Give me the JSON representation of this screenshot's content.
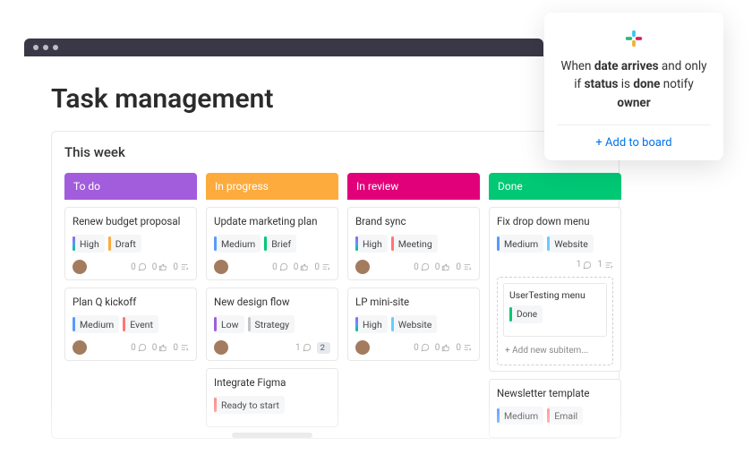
{
  "page": {
    "title": "Task management"
  },
  "board": {
    "title": "This  week"
  },
  "columns": [
    {
      "key": "todo",
      "label": "To do",
      "cards": [
        {
          "title": "Renew budget proposal",
          "tags": [
            {
              "text": "High",
              "bar": "c-grad"
            },
            {
              "text": "Draft",
              "bar": "c-orange"
            }
          ],
          "avatar": true,
          "comments": 0,
          "likes": 0,
          "sub": 0
        },
        {
          "title": "Plan Q kickoff",
          "tags": [
            {
              "text": "Medium",
              "bar": "c-blue"
            },
            {
              "text": "Event",
              "bar": "c-pink"
            }
          ],
          "avatar": true,
          "comments": 0,
          "likes": 0,
          "sub": 0
        }
      ]
    },
    {
      "key": "progress",
      "label": "In progress",
      "cards": [
        {
          "title": "Update marketing plan",
          "tags": [
            {
              "text": "Medium",
              "bar": "c-blue"
            },
            {
              "text": "Brief",
              "bar": "c-teal"
            }
          ],
          "avatar": true,
          "comments": 0,
          "likes": 0,
          "sub": 0
        },
        {
          "title": "New design flow",
          "tags": [
            {
              "text": "Low",
              "bar": "c-purple"
            },
            {
              "text": "Strategy",
              "bar": "c-grey"
            }
          ],
          "avatar": true,
          "comments": 1,
          "likes": null,
          "sub": 2,
          "sub_badge": true
        },
        {
          "title": "Integrate Figma",
          "tags": [
            {
              "text": "Ready to start",
              "bar": "c-salmon"
            }
          ],
          "avatar": false,
          "comments": null,
          "likes": null,
          "sub": null,
          "partial": true
        }
      ]
    },
    {
      "key": "review",
      "label": "In review",
      "cards": [
        {
          "title": "Brand sync",
          "tags": [
            {
              "text": "High",
              "bar": "c-grad"
            },
            {
              "text": "Meeting",
              "bar": "c-pink"
            }
          ],
          "avatar": true,
          "comments": 0,
          "likes": 0,
          "sub": 0
        },
        {
          "title": "LP mini-site",
          "tags": [
            {
              "text": "High",
              "bar": "c-grad"
            },
            {
              "text": "Website",
              "bar": "c-lblue"
            }
          ],
          "avatar": true,
          "comments": 0,
          "likes": 0,
          "sub": 0
        }
      ]
    },
    {
      "key": "done",
      "label": "Done",
      "cards": [
        {
          "title": "Fix drop down menu",
          "tags": [
            {
              "text": "Medium",
              "bar": "c-blue"
            },
            {
              "text": "Website",
              "bar": "c-lblue"
            }
          ],
          "avatar": false,
          "comments": 1,
          "likes": null,
          "sub": 1,
          "subitems": [
            {
              "title": "UserTesting menu",
              "tags": [
                {
                  "text": "Done",
                  "bar": "c-green"
                }
              ]
            }
          ],
          "add_sub_label": "+ Add new subitem..."
        },
        {
          "title": "Newsletter template",
          "tags": [
            {
              "text": "Medium",
              "bar": "c-blue"
            },
            {
              "text": "Email",
              "bar": "c-salmon"
            }
          ],
          "avatar": false,
          "comments": null,
          "likes": null,
          "sub": null,
          "partial": true
        }
      ]
    }
  ],
  "callout": {
    "text_parts": {
      "p1": "When ",
      "b1": "date arrives",
      "p2": " and only if ",
      "b2": "status",
      "p3": " is ",
      "b3": "done",
      "p4": " notify ",
      "b4": "owner"
    },
    "action": "+ Add to board"
  }
}
